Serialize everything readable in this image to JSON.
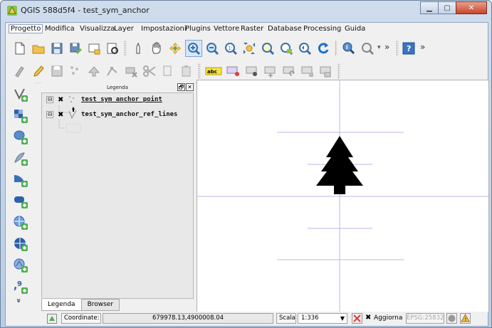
{
  "window": {
    "title": "QGIS 588d5f4 - test_sym_anchor",
    "minimize_glyph": "▁",
    "maximize_glyph": "▢",
    "close_glyph": "✕"
  },
  "menubar": {
    "items": [
      {
        "label": "Progetto"
      },
      {
        "label": "Modifica"
      },
      {
        "label": "Visualizza"
      },
      {
        "label": "Layer"
      },
      {
        "label": "Impostazioni"
      },
      {
        "label": "Plugins"
      },
      {
        "label": "Vettore"
      },
      {
        "label": "Raster"
      },
      {
        "label": "Database"
      },
      {
        "label": "Processing"
      },
      {
        "label": "Guida"
      }
    ]
  },
  "toolbar1": {
    "icons": [
      "new-project-icon",
      "open-project-icon",
      "save-project-icon",
      "save-as-icon",
      "new-print-composer-icon",
      "composer-manager-icon",
      "pan-touch-icon",
      "pan-icon",
      "pan-to-selection-icon",
      "zoom-in-icon",
      "zoom-out-icon",
      "zoom-native-icon",
      "zoom-full-icon",
      "zoom-to-selection-icon",
      "zoom-to-layer-icon",
      "zoom-last-icon",
      "refresh-icon",
      "identify-icon",
      "measure-icon",
      "overflow-icon",
      "help-icon"
    ],
    "overflow_glyph": "»"
  },
  "toolbar2": {
    "icons": [
      "current-edits-icon",
      "toggle-editing-icon",
      "save-edits-icon",
      "add-feature-icon",
      "move-feature-icon",
      "node-tool-icon",
      "delete-selected-icon",
      "cut-features-icon",
      "copy-features-icon",
      "paste-features-icon",
      "label-icon",
      "pin-label-icon",
      "show-hide-label-icon",
      "move-label-icon",
      "rotate-label-icon",
      "change-label-icon",
      "label-tool-icon"
    ],
    "label_badge": "abc"
  },
  "left_toolbar": {
    "icons": [
      "add-vector-layer-icon",
      "add-raster-layer-icon",
      "add-postgis-layer-icon",
      "add-spatialite-layer-icon",
      "add-mssql-layer-icon",
      "add-oracle-layer-icon",
      "add-wms-layer-icon",
      "add-wcs-layer-icon",
      "add-wfs-layer-icon",
      "add-delimited-text-icon",
      "more-icon"
    ],
    "more_glyph": "»"
  },
  "legend": {
    "title": "Legenda",
    "float_glyph": "🗗",
    "close_glyph": "✕",
    "layers": [
      {
        "name": "test_sym_anchor_point",
        "checked": true,
        "expander": "⊟",
        "check_glyph": "✖"
      },
      {
        "name": "test_sym_anchor_ref_lines",
        "checked": true,
        "expander": "⊟",
        "check_glyph": "✖"
      }
    ],
    "tabs": [
      {
        "label": "Legenda",
        "active": true
      },
      {
        "label": "Browser",
        "active": false
      }
    ]
  },
  "statusbar": {
    "coord_label": "Coordinate:",
    "coord_value": "679978.13,4900008.04",
    "scale_label": "Scala",
    "scale_value": "1:336",
    "render_label": "Aggiorna",
    "render_checked": true,
    "crs": "EPSG:25832"
  },
  "colors": {
    "ref_line": "#b9b9e8",
    "symbol": "#000000"
  }
}
